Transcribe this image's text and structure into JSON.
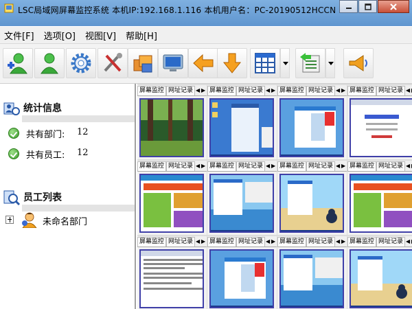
{
  "window": {
    "title": "LSC局域网屏幕监控系统    本机IP:192.168.1.116    本机用户名：PC-20190512HCCN"
  },
  "menu": [
    {
      "label": "文件[F]"
    },
    {
      "label": "选项[O]"
    },
    {
      "label": "视图[V]"
    },
    {
      "label": "帮助[H]"
    }
  ],
  "toolbar": {
    "buttons": [
      {
        "icon": "add-user-icon"
      },
      {
        "icon": "user-icon"
      },
      {
        "icon": "gear-icon"
      },
      {
        "icon": "tools-icon"
      },
      {
        "icon": "package-icon"
      },
      {
        "icon": "monitor-icon"
      },
      {
        "icon": "arrow-left-icon"
      },
      {
        "icon": "arrow-down-icon"
      },
      {
        "icon": "grid-layout-icon"
      },
      {
        "icon": "list-export-icon"
      },
      {
        "icon": "broadcast-icon"
      }
    ]
  },
  "stats": {
    "title": "统计信息",
    "departments_label": "共有部门:",
    "departments_value": "12",
    "employees_label": "共有员工:",
    "employees_value": "12"
  },
  "employees": {
    "title": "员工列表",
    "tree": [
      {
        "label": "未命名部门",
        "expanded": false
      }
    ]
  },
  "monitor_tile": {
    "tab_screen": "屏幕监控",
    "tab_url": "网址记录"
  },
  "tiles": [
    {
      "theme": "forest"
    },
    {
      "theme": "desktop-blue"
    },
    {
      "theme": "desktop-chat"
    },
    {
      "theme": "web-page"
    },
    {
      "theme": "web-busy"
    },
    {
      "theme": "desktop-sea"
    },
    {
      "theme": "desktop-beach"
    },
    {
      "theme": "web-busy"
    },
    {
      "theme": "web-text"
    },
    {
      "theme": "desktop-chat"
    },
    {
      "theme": "desktop-sea"
    },
    {
      "theme": "desktop-beach"
    }
  ],
  "colors": {
    "titlebar": "#6fa3d8",
    "tile_border": "#3f3fa8",
    "close_button": "#c85038"
  }
}
